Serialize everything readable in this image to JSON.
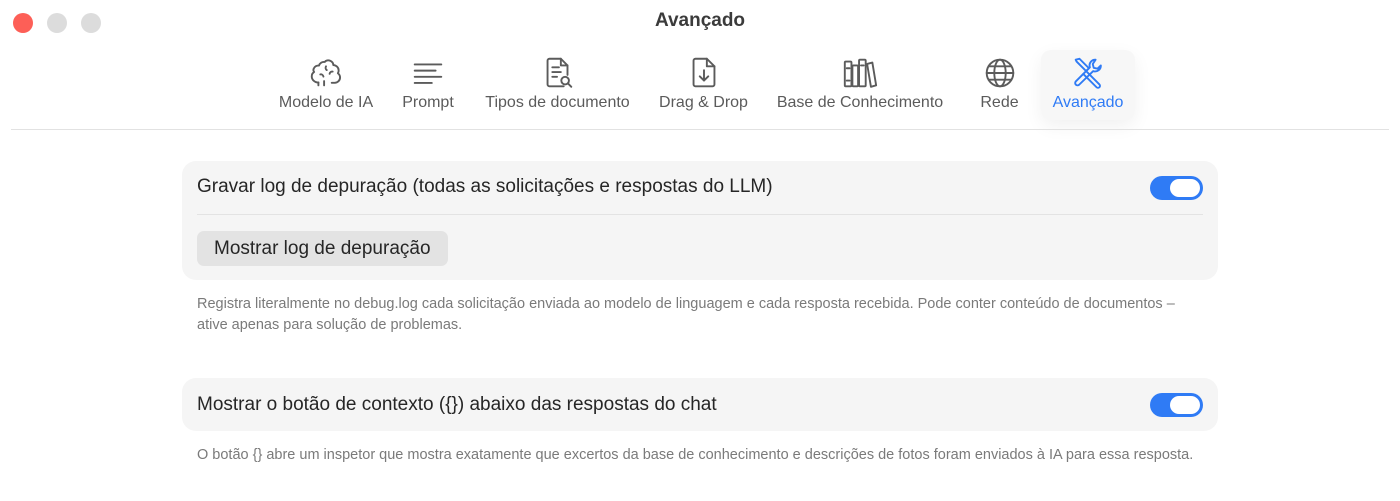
{
  "window": {
    "title": "Avançado"
  },
  "tabs": [
    {
      "label": "Modelo de IA",
      "icon": "brain-icon"
    },
    {
      "label": "Prompt",
      "icon": "text-lines-icon"
    },
    {
      "label": "Tipos de documento",
      "icon": "document-search-icon"
    },
    {
      "label": "Drag & Drop",
      "icon": "document-download-icon"
    },
    {
      "label": "Base de Conhecimento",
      "icon": "books-icon"
    },
    {
      "label": "Rede",
      "icon": "globe-icon"
    },
    {
      "label": "Avançado",
      "icon": "wrench-screwdriver-icon",
      "active": true
    }
  ],
  "debug": {
    "toggle_label": "Gravar log de depuração (todas as solicitações e respostas do LLM)",
    "toggle_on": true,
    "button_label": "Mostrar log de depuração",
    "help": "Registra literalmente no debug.log cada solicitação enviada ao modelo de linguagem e cada resposta recebida. Pode conter conteúdo de documentos – ative apenas para solução de problemas."
  },
  "context": {
    "toggle_label": "Mostrar o botão de contexto ({}) abaixo das respostas do chat",
    "toggle_on": true,
    "help": "O botão {} abre um inspetor que mostra exatamente que excertos da base de conhecimento e descrições de fotos foram enviados à IA para essa resposta."
  },
  "colors": {
    "accent": "#2f7bf5",
    "close": "#fd5f57",
    "card_bg": "#f5f5f5"
  }
}
